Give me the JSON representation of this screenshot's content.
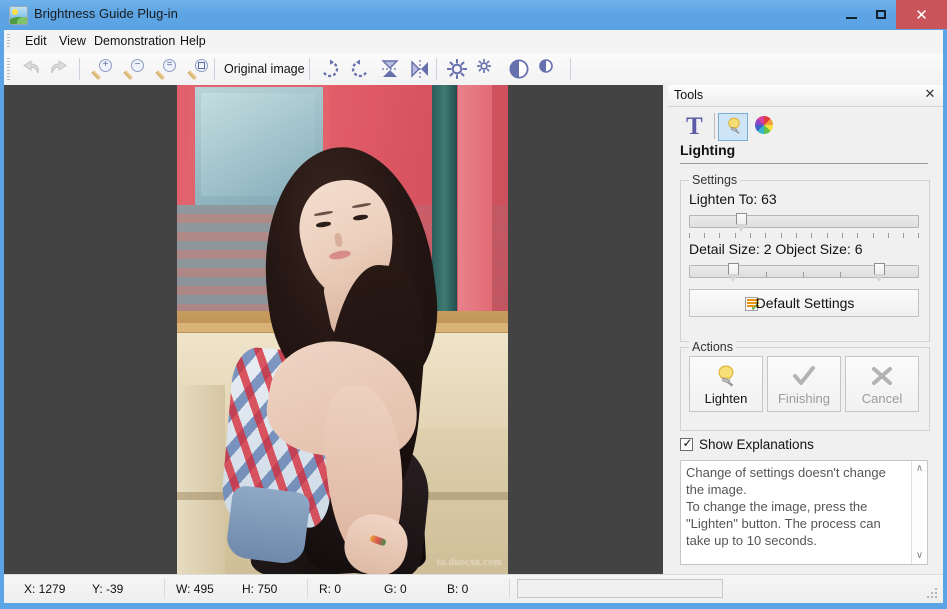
{
  "window": {
    "title": "Brightness Guide Plug-in",
    "icon": "image-sun-icon",
    "controls": {
      "minimize": "–",
      "maximize": "□",
      "close": "✕"
    }
  },
  "menu": {
    "items": [
      {
        "label": "Edit"
      },
      {
        "label": "View"
      },
      {
        "label": "Demonstration"
      },
      {
        "label": "Help"
      }
    ]
  },
  "toolbar": {
    "undo": "undo-icon",
    "redo": "redo-icon",
    "zoom_in": "zoom-in-icon",
    "zoom_out": "zoom-out-icon",
    "zoom_actual": "zoom-actual-size-icon",
    "zoom_fit": "zoom-fit-icon",
    "original_image_label": "Original image",
    "rotate_cw": "rotate-clockwise-icon",
    "rotate_ccw": "rotate-counterclockwise-icon",
    "flip_vertical": "flip-vertical-icon",
    "flip_horizontal": "flip-horizontal-icon",
    "brightness_up": "brightness-increase-icon",
    "brightness_down": "brightness-decrease-icon",
    "contrast_up": "contrast-increase-icon",
    "contrast_down": "contrast-decrease-icon"
  },
  "canvas": {
    "watermark": "tu.duocsn.com",
    "background_color": "#434343"
  },
  "tools": {
    "header_title": "Tools",
    "close_label": "✕",
    "tool_icons": [
      {
        "name": "text-tool-icon",
        "glyph": "T",
        "selected": false
      },
      {
        "name": "lighting-tool-icon",
        "glyph": "lightbulb",
        "selected": true
      },
      {
        "name": "color-tool-icon",
        "glyph": "color-wheel",
        "selected": false
      }
    ],
    "section_title": "Lighting",
    "settings": {
      "group_label": "Settings",
      "lighten_label": "Lighten To: 63",
      "lighten_value": 63,
      "sizes_label": "Detail Size: 2  Object Size: 6",
      "detail_size": 2,
      "object_size": 6,
      "default_button": "Default Settings"
    },
    "actions": {
      "group_label": "Actions",
      "buttons": [
        {
          "label": "Lighten",
          "icon": "lightbulb-icon",
          "enabled": true
        },
        {
          "label": "Finishing",
          "icon": "checkmark-icon",
          "enabled": false
        },
        {
          "label": "Cancel",
          "icon": "cross-icon",
          "enabled": false
        }
      ]
    },
    "show_explanations": {
      "label": "Show Explanations",
      "checked": true
    },
    "explanation_text": "Change of settings doesn't change the image.\nTo change the image, press the \"Lighten\" button. The process can take up to 10 seconds."
  },
  "statusbar": {
    "x": "X: 1279",
    "y": "Y: -39",
    "w": "W: 495",
    "h": "H: 750",
    "r": "R: 0",
    "g": "G: 0",
    "b": "B: 0"
  },
  "colors": {
    "titlebar": "#5da5e4",
    "close_button": "#c9555a",
    "accent_icon": "#6670ad",
    "canvas_bg": "#434343"
  }
}
